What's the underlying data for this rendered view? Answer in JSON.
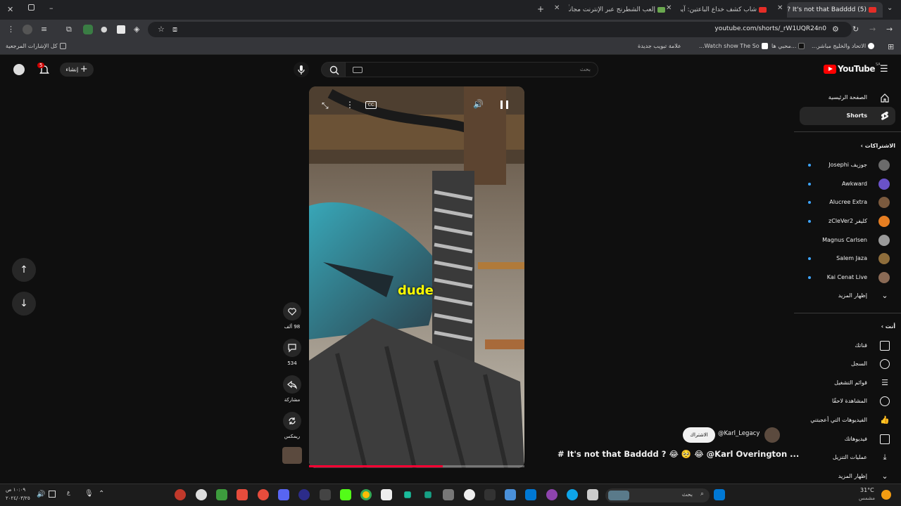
{
  "browser": {
    "tabs": [
      {
        "title": "(5) It's not that Badddd ?",
        "active": true
      },
      {
        "title": "شاب كشف خداع الباعتين: آيفون",
        "active": false
      },
      {
        "title": "إلعب الشطرنج عبر الإنترنت مجاناً",
        "active": false
      }
    ],
    "url": "youtube.com/shorts/_rW1UQR24n0",
    "bookmarks": [
      {
        "label": "كل الإشارات المرجعية"
      },
      {
        "label": "الاتحاد والخليج مباشر..."
      },
      {
        "label": "...محبي ها"
      },
      {
        "label": "Watch show The So..."
      },
      {
        "label": "علامة تبويب جديدة"
      }
    ]
  },
  "youtube": {
    "logo_text": "YouTube",
    "logo_region": "SA",
    "search_placeholder": "بحث",
    "create_label": "إنشاء",
    "notification_count": "5",
    "sidebar": {
      "home": "الصفحة الرئيسية",
      "shorts": "Shorts",
      "subscriptions_title": "الاشتراكات",
      "subscriptions": [
        {
          "name": "جوزيف Josephi",
          "avatar_color": "#6b6b6b"
        },
        {
          "name": "Awkward",
          "avatar_color": "#6a52c9"
        },
        {
          "name": "Alucree Extra",
          "avatar_color": "#7b5a3e"
        },
        {
          "name": "كليفر zCleVer2",
          "avatar_color": "#e67e22"
        },
        {
          "name": "Magnus Carlsen",
          "avatar_color": "#9a9a9a"
        },
        {
          "name": "Salem Jaza",
          "avatar_color": "#8e6d3b"
        },
        {
          "name": "Kai Cenat Live",
          "avatar_color": "#8a6a55"
        }
      ],
      "show_more": "إظهار المزيد",
      "you_title": "أنت",
      "you_items": [
        {
          "label": "قناتك",
          "icon": "channel-icon"
        },
        {
          "label": "السجل",
          "icon": "history-icon"
        },
        {
          "label": "قوائم التشغيل",
          "icon": "playlists-icon"
        },
        {
          "label": "المشاهدة لاحقًا",
          "icon": "watch-later-icon"
        },
        {
          "label": "الفيديوهات التي أعجبتني",
          "icon": "like-icon"
        },
        {
          "label": "فيديوهاتك",
          "icon": "your-videos-icon"
        },
        {
          "label": "عمليات التنزيل",
          "icon": "download-icon"
        },
        {
          "label": "إظهار المزيد",
          "icon": "chevron-down-icon"
        }
      ]
    },
    "short": {
      "caption": "dude",
      "likes": "98 ألف",
      "comments": "534",
      "share": "مشاركة",
      "remix": "ريمكس",
      "channel": "@Karl_Legacy",
      "subscribe": "الاشتراك",
      "title": "# It's not that Badddd ? 😂 🥺 😂 @Karl Overington ...",
      "progress": 0.62
    }
  },
  "taskbar": {
    "search_placeholder": "بحث",
    "weather_temp": "31°C",
    "weather_desc": "مشمس",
    "time": "١٠:٠٩ ص",
    "date": "٢٠٢٤/٠٣/٢٥",
    "lang": "ع"
  }
}
